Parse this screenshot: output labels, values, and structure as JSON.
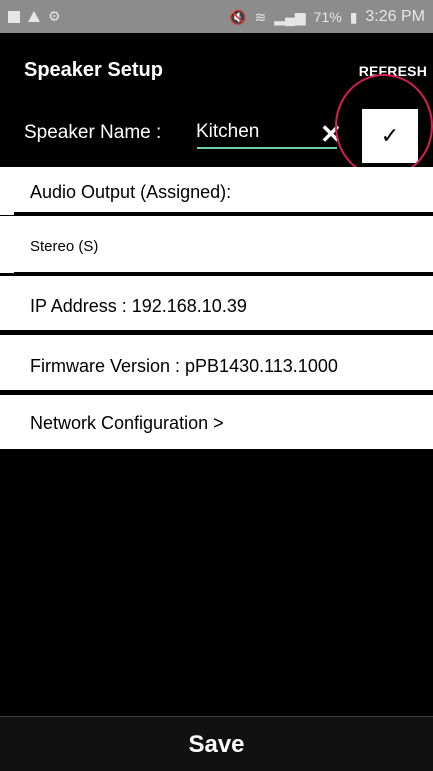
{
  "status_bar": {
    "left_icons": [
      "gallery-icon",
      "warning-icon",
      "notification-icon"
    ],
    "right_icons": [
      "mute-icon",
      "nfc-icon",
      "wifi-icon",
      "signal-icon",
      "battery-icon"
    ],
    "battery": "71%",
    "time": "3:26 PM"
  },
  "header": {
    "title": "Speaker Setup",
    "refresh_label": "REFRESH"
  },
  "speaker_name": {
    "label": "Speaker Name :",
    "value": "Kitchen",
    "clear_glyph": "✕",
    "confirm_glyph": "✓"
  },
  "rows": {
    "audio_output_label": "Audio Output (Assigned):",
    "audio_output_value": "Stereo (S)",
    "ip_address": "IP  Address : 192.168.10.39",
    "firmware_version": "Firmware  Version : pPB1430.113.1000",
    "network_configuration": "Network  Configuration >"
  },
  "footer": {
    "save_label": "Save"
  },
  "colors": {
    "accent_underline": "#6fd1a6",
    "highlight_circle": "#d62050"
  }
}
